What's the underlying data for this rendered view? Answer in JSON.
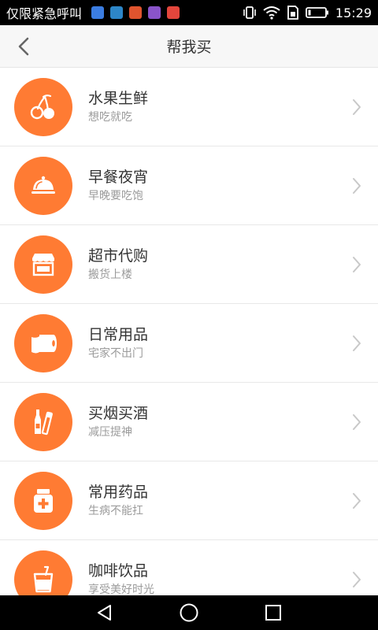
{
  "status_bar": {
    "carrier_text": "仅限紧急呼叫",
    "time": "15:29",
    "notification_icons": [
      {
        "name": "app-notification-icon",
        "color": "#3b7de1"
      },
      {
        "name": "app-notification-icon",
        "color": "#2d86c8"
      },
      {
        "name": "app-notification-icon",
        "color": "#e0542e"
      },
      {
        "name": "app-notification-icon",
        "color": "#8a54c9"
      },
      {
        "name": "app-notification-icon",
        "color": "#e3463c"
      }
    ]
  },
  "header": {
    "title": "帮我买"
  },
  "colors": {
    "accent": "#ff7b33"
  },
  "items": [
    {
      "title": "水果生鲜",
      "subtitle": "想吃就吃",
      "icon": "cherry-icon"
    },
    {
      "title": "早餐夜宵",
      "subtitle": "早晚要吃饱",
      "icon": "food-cloche-icon"
    },
    {
      "title": "超市代购",
      "subtitle": "搬货上楼",
      "icon": "storefront-icon"
    },
    {
      "title": "日常用品",
      "subtitle": "宅家不出门",
      "icon": "tissue-roll-icon"
    },
    {
      "title": "买烟买酒",
      "subtitle": "减压提神",
      "icon": "bottle-cigarette-icon"
    },
    {
      "title": "常用药品",
      "subtitle": "生病不能扛",
      "icon": "medicine-bottle-icon"
    },
    {
      "title": "咖啡饮品",
      "subtitle": "享受美好时光",
      "icon": "drink-cup-icon"
    }
  ]
}
